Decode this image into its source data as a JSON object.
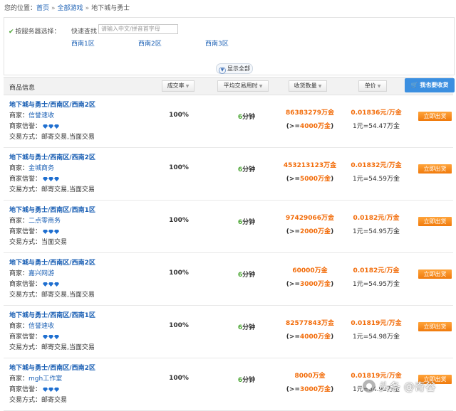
{
  "breadcrumb": {
    "prefix": "您的位置：",
    "home": "首页",
    "all_games": "全部游戏",
    "current": "地下城与勇士",
    "sep": "»"
  },
  "filter": {
    "server_label": "按服务器选择：",
    "quick_label": "快速查找",
    "search_placeholder": "请输入中文/拼音首字母",
    "servers": [
      "西南1区",
      "西南2区",
      "西南3区"
    ],
    "show_all": "显示全部"
  },
  "table": {
    "col_info": "商品信息",
    "col_rate": "成交率",
    "col_time": "平均交易用时",
    "col_qty": "收货数量",
    "col_price": "单价",
    "sell_button": "我也要收货"
  },
  "labels": {
    "seller": "商家：",
    "credit": "商家信誉：",
    "trade": "交易方式："
  },
  "rows": [
    {
      "title": "地下城与勇士/西南区/西南2区",
      "seller": "信誉速收",
      "credit_level": 3,
      "trade": "邮寄交易,当面交易",
      "rate": "100%",
      "time_num": "6",
      "time_unit": "分钟",
      "qty": "86383279万金",
      "min_prefix": "(>=",
      "min_qty": "4000万金",
      "min_suffix": ")",
      "price": "0.01836元/万金",
      "unit": "1元=54.47万金",
      "buy": "立即出货"
    },
    {
      "title": "地下城与勇士/西南区/西南2区",
      "seller": "金城商务",
      "credit_level": 3,
      "trade": "邮寄交易,当面交易",
      "rate": "100%",
      "time_num": "6",
      "time_unit": "分钟",
      "qty": "453213123万金",
      "min_prefix": "(>=",
      "min_qty": "5000万金",
      "min_suffix": ")",
      "price": "0.01832元/万金",
      "unit": "1元=54.59万金",
      "buy": "立即出货"
    },
    {
      "title": "地下城与勇士/西南区/西南1区",
      "seller": "二点零商务",
      "credit_level": 3,
      "trade": "当面交易",
      "rate": "100%",
      "time_num": "6",
      "time_unit": "分钟",
      "qty": "97429066万金",
      "min_prefix": "(>=",
      "min_qty": "2000万金",
      "min_suffix": ")",
      "price": "0.0182元/万金",
      "unit": "1元=54.95万金",
      "buy": "立即出货"
    },
    {
      "title": "地下城与勇士/西南区/西南2区",
      "seller": "嘉兴网游",
      "credit_level": 3,
      "trade": "邮寄交易,当面交易",
      "rate": "100%",
      "time_num": "6",
      "time_unit": "分钟",
      "qty": "60000万金",
      "min_prefix": "(>=",
      "min_qty": "3000万金",
      "min_suffix": ")",
      "price": "0.0182元/万金",
      "unit": "1元=54.95万金",
      "buy": "立即出货"
    },
    {
      "title": "地下城与勇士/西南区/西南1区",
      "seller": "信誉速收",
      "credit_level": 3,
      "trade": "邮寄交易,当面交易",
      "rate": "100%",
      "time_num": "6",
      "time_unit": "分钟",
      "qty": "82577843万金",
      "min_prefix": "(>=",
      "min_qty": "4000万金",
      "min_suffix": ")",
      "price": "0.01819元/万金",
      "unit": "1元=54.98万金",
      "buy": "立即出货"
    },
    {
      "title": "地下城与勇士/西南区/西南2区",
      "seller": "mgh工作室",
      "credit_level": 3,
      "trade": "邮寄交易",
      "rate": "100%",
      "time_num": "6",
      "time_unit": "分钟",
      "qty": "8000万金",
      "min_prefix": "(>=",
      "min_qty": "3000万金",
      "min_suffix": ")",
      "price": "0.01819元/万金",
      "unit": "1元=54.95万金",
      "buy": "立即出货"
    }
  ],
  "watermark": "头条 @奇谷",
  "colors": {
    "link": "#1a5fb4",
    "orange": "#f26b08",
    "green": "#4aa532",
    "sell_button": "#3b8fe0",
    "buy_button": "#f07a0c"
  }
}
